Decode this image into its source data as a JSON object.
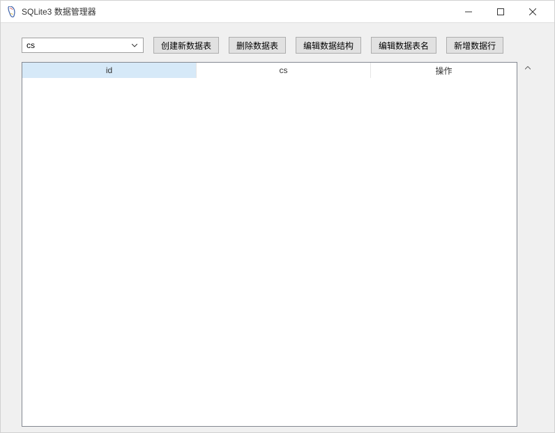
{
  "window": {
    "title": "SQLite3 数据管理器"
  },
  "toolbar": {
    "dropdown_value": "cs",
    "create_table_label": "创建新数据表",
    "delete_table_label": "删除数据表",
    "edit_structure_label": "编辑数据结构",
    "edit_table_name_label": "编辑数据表名",
    "add_row_label": "新增数据行"
  },
  "table": {
    "columns": [
      {
        "key": "id",
        "label": "id",
        "selected": true
      },
      {
        "key": "cs",
        "label": "cs",
        "selected": false
      },
      {
        "key": "op",
        "label": "操作",
        "selected": false
      }
    ],
    "rows": []
  }
}
